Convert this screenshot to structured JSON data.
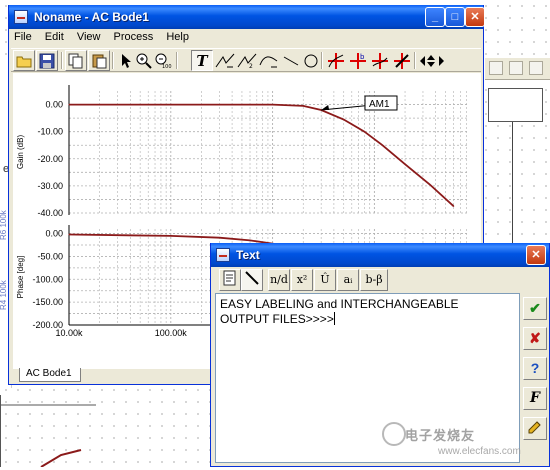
{
  "bode_window": {
    "title": "Noname - AC Bode1",
    "controls": {
      "minimize": "_",
      "maximize": "□",
      "close": "✕"
    },
    "menu": [
      "File",
      "Edit",
      "View",
      "Process",
      "Help"
    ],
    "toolbar_icons": [
      "open-folder",
      "save",
      "copy",
      "paste",
      "pointer",
      "zoom-in",
      "zoom-out-100",
      "text-tool",
      "draw-tool-1",
      "draw-tool-2",
      "draw-tool-3",
      "line-tool",
      "circle-tool",
      "cursor-tool-1",
      "cursor-tool-2",
      "cursor-tool-3",
      "cursor-tool-4",
      "nav-arrows"
    ],
    "tab_label": "AC Bode1"
  },
  "chart_data": [
    {
      "type": "line",
      "title": "",
      "xlabel": "",
      "ylabel": "Gain (dB)",
      "x_scale": "log",
      "y_ticks": [
        "0.00",
        "-10.00",
        "-20.00",
        "-30.00",
        "-40.00"
      ],
      "ylim": [
        -40,
        5
      ],
      "grid": true,
      "annotation": "AM1",
      "series": [
        {
          "color": "#8b1a1a",
          "x": [
            10000,
            100000,
            1000000,
            2000000,
            3000000,
            5000000,
            8000000,
            12000000,
            20000000,
            35000000,
            60000000
          ],
          "values": [
            0,
            0,
            0,
            -0.5,
            -2,
            -5.5,
            -10,
            -15,
            -22,
            -29.5,
            -37.5
          ]
        }
      ]
    },
    {
      "type": "line",
      "title": "",
      "xlabel": "",
      "ylabel": "Phase [deg]",
      "x_scale": "log",
      "x_ticks": [
        "10.00k",
        "100.00k"
      ],
      "y_ticks": [
        "0.00",
        "-50.00",
        "-100.00",
        "-150.00",
        "-200.00"
      ],
      "ylim": [
        -200,
        10
      ],
      "grid": true,
      "series": [
        {
          "color": "#8b1a1a",
          "x": [
            10000,
            100000,
            300000,
            600000,
            1000000,
            2000000
          ],
          "values": [
            -2,
            -5,
            -9,
            -15,
            -22,
            -35
          ]
        }
      ]
    }
  ],
  "text_dialog": {
    "title": "Text",
    "controls": {
      "close": "✕"
    },
    "format_buttons": [
      "n/d",
      "x²",
      "Û",
      "aᵢ",
      "b-β"
    ],
    "text_value": "EASY LABELING and INTERCHANGEABLE\nOUTPUT FILES>>>>",
    "side_buttons": {
      "ok": "✔",
      "cancel": "✘",
      "help": "?",
      "font": "F"
    }
  },
  "background_app": {
    "left_letter": "e",
    "left_labels": [
      "R6 100k",
      "R4 100k"
    ]
  },
  "watermark": {
    "text": "电子发烧友",
    "sub": "www.elecfans.com"
  }
}
